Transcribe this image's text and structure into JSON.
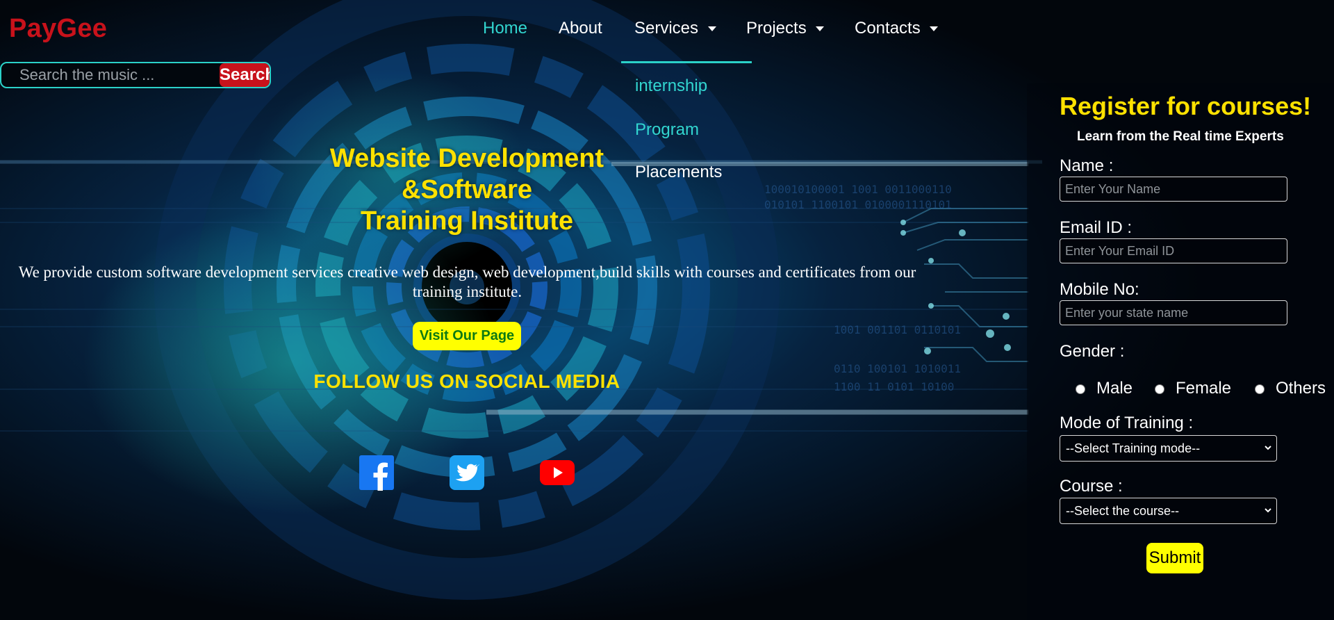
{
  "brand": {
    "logo": "PayGee"
  },
  "search": {
    "placeholder": "Search the music ...",
    "button_label": "Search"
  },
  "nav": {
    "items": [
      {
        "label": "Home",
        "active": true,
        "has_dropdown": false
      },
      {
        "label": "About",
        "active": false,
        "has_dropdown": false
      },
      {
        "label": "Services",
        "active": false,
        "has_dropdown": true
      },
      {
        "label": "Projects",
        "active": false,
        "has_dropdown": true
      },
      {
        "label": "Contacts",
        "active": false,
        "has_dropdown": true
      }
    ],
    "services_dropdown": [
      {
        "label": "internship",
        "highlighted": true
      },
      {
        "label": "Program",
        "highlighted": true
      },
      {
        "label": "Placements",
        "highlighted": false
      }
    ]
  },
  "hero": {
    "title_lines": [
      "Website Development",
      "&Software",
      "Training Institute"
    ],
    "description": "We provide custom software development services creative web design, web development,build skills with courses and certificates from our training institute.",
    "visit_button": "Visit Our Page",
    "follow_title": "FOLLOW US ON SOCIAL MEDIA"
  },
  "social": [
    {
      "icon": "facebook-icon",
      "color": "#1877f2"
    },
    {
      "icon": "twitter-icon",
      "color": "#1da1f2"
    },
    {
      "icon": "youtube-icon",
      "color": "#ff0000"
    }
  ],
  "form": {
    "title": "Register for courses!",
    "subtitle": "Learn from the Real time Experts",
    "name": {
      "label": "Name :",
      "placeholder": "Enter Your Name",
      "value": ""
    },
    "email": {
      "label": "Email ID :",
      "placeholder": "Enter Your Email ID",
      "value": ""
    },
    "mobile": {
      "label": "Mobile No:",
      "placeholder": "Enter your state name",
      "value": ""
    },
    "gender": {
      "label": "Gender :",
      "options": [
        "Male",
        "Female",
        "Others"
      ]
    },
    "mode": {
      "label": "Mode of Training :",
      "selected": "--Select Training mode--"
    },
    "course": {
      "label": "Course :",
      "selected": "--Select the course--"
    },
    "submit_label": "Submit"
  },
  "colors": {
    "accent_cyan": "#32d6d0",
    "brand_red": "#c8121b",
    "title_yellow": "#ffe100",
    "button_yellow": "#ffff00"
  }
}
